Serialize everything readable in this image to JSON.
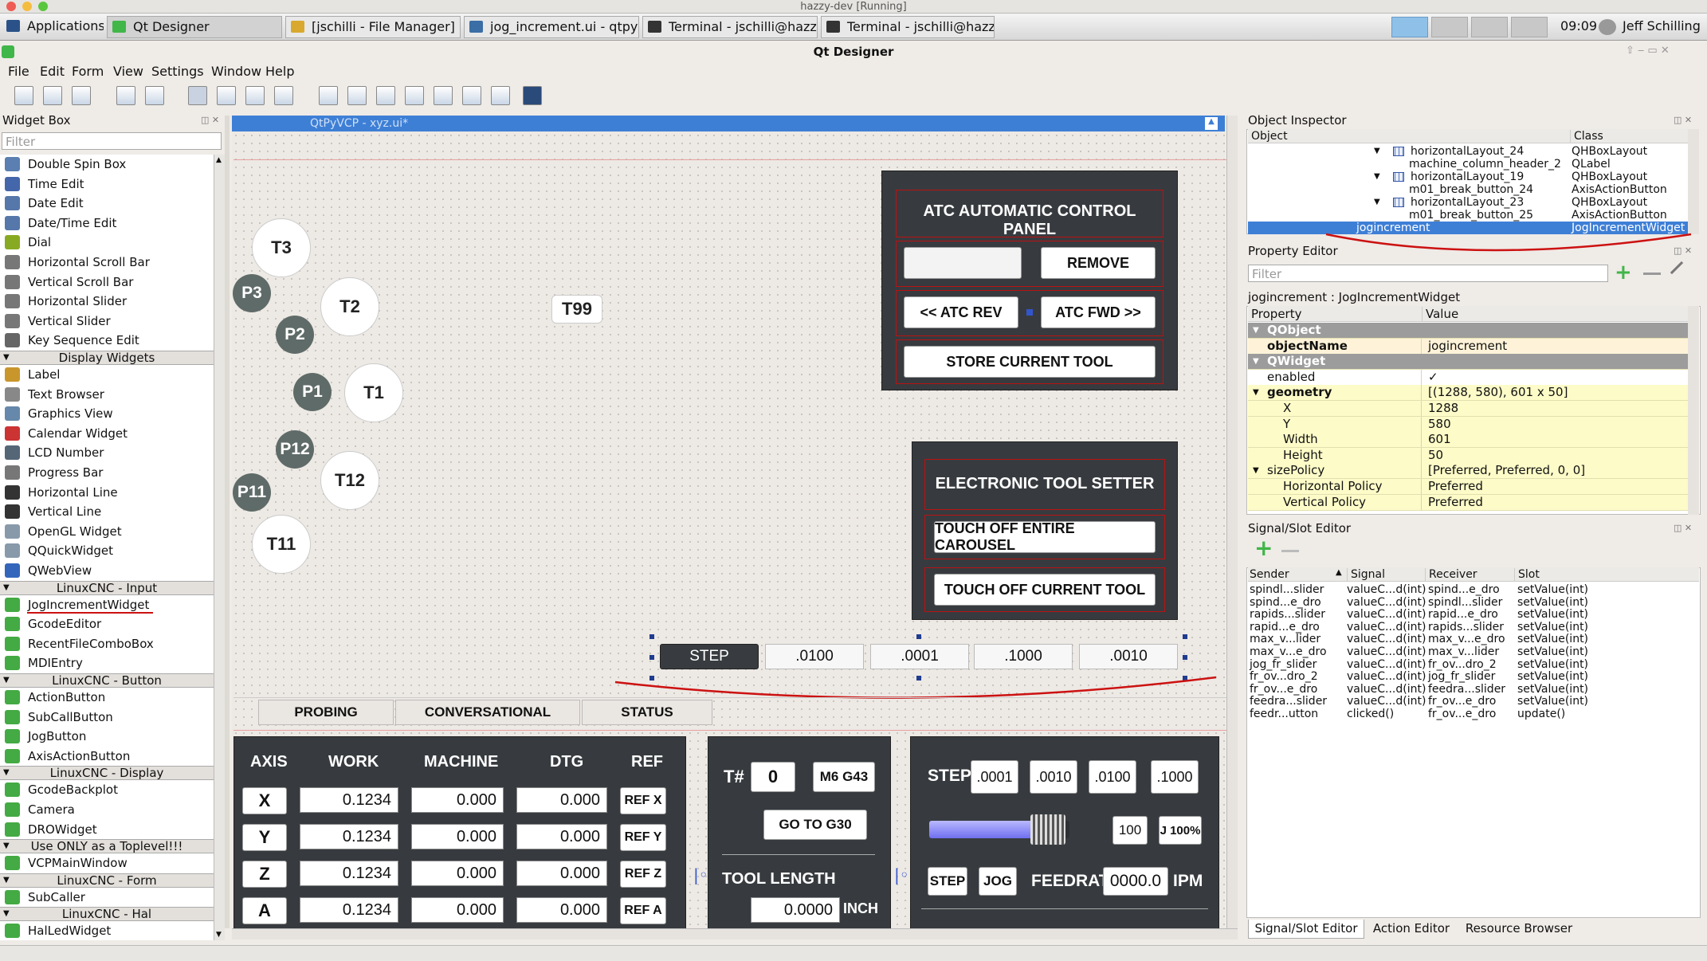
{
  "window": {
    "title": "hazzy-dev [Running]",
    "app_title": "Qt Designer"
  },
  "taskbar": {
    "applications": "Applications",
    "tasks": [
      "Qt Designer",
      "[jschilli - File Manager]",
      "jog_increment.ui - qtpyv...",
      "Terminal - jschilli@hazz...",
      "Terminal - jschilli@hazz..."
    ],
    "clock": "09:09",
    "user": "Jeff Schilling"
  },
  "menu": [
    "File",
    "Edit",
    "Form",
    "View",
    "Settings",
    "Window",
    "Help"
  ],
  "widget_box": {
    "title": "Widget Box",
    "filter_placeholder": "Filter",
    "items": [
      {
        "t": "item",
        "label": "Double Spin Box",
        "color": "#5a7fb0"
      },
      {
        "t": "item",
        "label": "Time Edit",
        "color": "#4466aa"
      },
      {
        "t": "item",
        "label": "Date Edit",
        "color": "#5577aa"
      },
      {
        "t": "item",
        "label": "Date/Time Edit",
        "color": "#5577aa"
      },
      {
        "t": "item",
        "label": "Dial",
        "color": "#88aa22"
      },
      {
        "t": "item",
        "label": "Horizontal Scroll Bar",
        "color": "#777777"
      },
      {
        "t": "item",
        "label": "Vertical Scroll Bar",
        "color": "#777777"
      },
      {
        "t": "item",
        "label": "Horizontal Slider",
        "color": "#777777"
      },
      {
        "t": "item",
        "label": "Vertical Slider",
        "color": "#777777"
      },
      {
        "t": "item",
        "label": "Key Sequence Edit",
        "color": "#666666"
      },
      {
        "t": "cat",
        "label": "Display Widgets"
      },
      {
        "t": "item",
        "label": "Label",
        "color": "#c9962c"
      },
      {
        "t": "item",
        "label": "Text Browser",
        "color": "#888888"
      },
      {
        "t": "item",
        "label": "Graphics View",
        "color": "#6688aa"
      },
      {
        "t": "item",
        "label": "Calendar Widget",
        "color": "#cc3333"
      },
      {
        "t": "item",
        "label": "LCD Number",
        "color": "#556677"
      },
      {
        "t": "item",
        "label": "Progress Bar",
        "color": "#777777"
      },
      {
        "t": "item",
        "label": "Horizontal Line",
        "color": "#333333"
      },
      {
        "t": "item",
        "label": "Vertical Line",
        "color": "#333333"
      },
      {
        "t": "item",
        "label": "OpenGL Widget",
        "color": "#8899aa"
      },
      {
        "t": "item",
        "label": "QQuickWidget",
        "color": "#8899aa"
      },
      {
        "t": "item",
        "label": "QWebView",
        "color": "#3366bb"
      },
      {
        "t": "cat",
        "label": "LinuxCNC - Input"
      },
      {
        "t": "item",
        "label": "JogIncrementWidget",
        "color": "#44aa44"
      },
      {
        "t": "item",
        "label": "GcodeEditor",
        "color": "#44aa44"
      },
      {
        "t": "item",
        "label": "RecentFileComboBox",
        "color": "#44aa44"
      },
      {
        "t": "item",
        "label": "MDIEntry",
        "color": "#44aa44"
      },
      {
        "t": "cat",
        "label": "LinuxCNC - Button"
      },
      {
        "t": "item",
        "label": "ActionButton",
        "color": "#44aa44"
      },
      {
        "t": "item",
        "label": "SubCallButton",
        "color": "#44aa44"
      },
      {
        "t": "item",
        "label": "JogButton",
        "color": "#44aa44"
      },
      {
        "t": "item",
        "label": "AxisActionButton",
        "color": "#44aa44"
      },
      {
        "t": "cat",
        "label": "LinuxCNC - Display"
      },
      {
        "t": "item",
        "label": "GcodeBackplot",
        "color": "#44aa44"
      },
      {
        "t": "item",
        "label": "Camera",
        "color": "#44aa44"
      },
      {
        "t": "item",
        "label": "DROWidget",
        "color": "#44aa44"
      },
      {
        "t": "cat",
        "label": "Use ONLY as a Toplevel!!!"
      },
      {
        "t": "item",
        "label": "VCPMainWindow",
        "color": "#44aa44"
      },
      {
        "t": "cat",
        "label": "LinuxCNC - Form"
      },
      {
        "t": "item",
        "label": "SubCaller",
        "color": "#44aa44"
      },
      {
        "t": "cat",
        "label": "LinuxCNC - Hal"
      },
      {
        "t": "item",
        "label": "HalLedWidget",
        "color": "#44aa44"
      }
    ]
  },
  "form": {
    "title": "QtPyVCP - xyz.ui*",
    "tools": [
      "T3",
      "T2",
      "T1",
      "T12",
      "T11"
    ],
    "pockets": [
      "P3",
      "P2",
      "P1",
      "P12",
      "P11"
    ],
    "t99": "T99",
    "atc": {
      "title": "ATC AUTOMATIC CONTROL PANEL",
      "remove": "REMOVE",
      "rev": "<< ATC REV",
      "fwd": "ATC FWD >>",
      "store": "STORE CURRENT TOOL"
    },
    "ets": {
      "title": "ELECTRONIC TOOL SETTER",
      "carousel": "TOUCH OFF ENTIRE CAROUSEL",
      "current": "TOUCH OFF CURRENT TOOL"
    },
    "jogbar": {
      "step": "STEP",
      "incs": [
        ".0100",
        ".0001",
        ".1000",
        ".0010"
      ]
    },
    "tabs": [
      "PROBING",
      "CONVERSATIONAL",
      "STATUS"
    ],
    "dro": {
      "headers": [
        "AXIS",
        "WORK",
        "MACHINE",
        "DTG",
        "REF"
      ],
      "rows": [
        {
          "axis": "X",
          "work": "0.1234",
          "machine": "0.000",
          "dtg": "0.000",
          "ref": "REF X"
        },
        {
          "axis": "Y",
          "work": "0.1234",
          "machine": "0.000",
          "dtg": "0.000",
          "ref": "REF Y"
        },
        {
          "axis": "Z",
          "work": "0.1234",
          "machine": "0.000",
          "dtg": "0.000",
          "ref": "REF Z"
        },
        {
          "axis": "A",
          "work": "0.1234",
          "machine": "0.000",
          "dtg": "0.000",
          "ref": "REF A"
        }
      ]
    },
    "toolinfo": {
      "tnum_label": "T#",
      "tnum": "0",
      "m6": "M6 G43",
      "g30": "GO TO G30",
      "tool_length_label": "TOOL LENGTH",
      "tool_length": "0.0000",
      "unit": "INCH"
    },
    "jog": {
      "step_label": "STEP",
      "incs": [
        ".0001",
        ".0010",
        ".0100",
        ".1000"
      ],
      "slider_value": "100",
      "jog_pct": "J 100%",
      "slider_fraction": 0.78,
      "step_btn": "STEP",
      "jog_btn": "JOG",
      "feedrate_label": "FEEDRATE",
      "feedrate": "0000.0",
      "ipm": "IPM"
    }
  },
  "object_inspector": {
    "title": "Object Inspector",
    "col_object": "Object",
    "col_class": "Class",
    "rows": [
      {
        "obj": "horizontalLayout_24",
        "cls": "QHBoxLayout",
        "indent": 1
      },
      {
        "obj": "machine_column_header_2",
        "cls": "QLabel",
        "indent": 2
      },
      {
        "obj": "horizontalLayout_19",
        "cls": "QHBoxLayout",
        "indent": 1
      },
      {
        "obj": "m01_break_button_24",
        "cls": "AxisActionButton",
        "indent": 2
      },
      {
        "obj": "horizontalLayout_23",
        "cls": "QHBoxLayout",
        "indent": 1
      },
      {
        "obj": "m01_break_button_25",
        "cls": "AxisActionButton",
        "indent": 2
      },
      {
        "obj": "jogincrement",
        "cls": "JogIncrementWidget",
        "indent": 0,
        "selected": true
      }
    ]
  },
  "property_editor": {
    "title": "Property Editor",
    "filter_placeholder": "Filter",
    "header": "jogincrement : JogIncrementWidget",
    "col_property": "Property",
    "col_value": "Value",
    "rows": [
      {
        "k": "QObject",
        "v": "",
        "type": "group"
      },
      {
        "k": "objectName",
        "v": "jogincrement",
        "type": "bold"
      },
      {
        "k": "QWidget",
        "v": "",
        "type": "group"
      },
      {
        "k": "enabled",
        "v": "✓",
        "type": "plain"
      },
      {
        "k": "geometry",
        "v": "[(1288, 580), 601 x 50]",
        "type": "bold"
      },
      {
        "k": "X",
        "v": "1288",
        "type": "sub"
      },
      {
        "k": "Y",
        "v": "580",
        "type": "sub"
      },
      {
        "k": "Width",
        "v": "601",
        "type": "sub"
      },
      {
        "k": "Height",
        "v": "50",
        "type": "sub"
      },
      {
        "k": "sizePolicy",
        "v": "[Preferred, Preferred, 0, 0]",
        "type": "plain"
      },
      {
        "k": "Horizontal Policy",
        "v": "Preferred",
        "type": "sub"
      },
      {
        "k": "Vertical Policy",
        "v": "Preferred",
        "type": "sub"
      }
    ]
  },
  "signal_slot": {
    "title": "Signal/Slot Editor",
    "cols": [
      "Sender",
      "Signal",
      "Receiver",
      "Slot"
    ],
    "rows": [
      [
        "spindl...slider",
        "valueC...d(int)",
        "spind...e_dro",
        "setValue(int)"
      ],
      [
        "spind...e_dro",
        "valueC...d(int)",
        "spindl...slider",
        "setValue(int)"
      ],
      [
        "rapids...slider",
        "valueC...d(int)",
        "rapid...e_dro",
        "setValue(int)"
      ],
      [
        "rapid...e_dro",
        "valueC...d(int)",
        "rapids...slider",
        "setValue(int)"
      ],
      [
        "max_v...lider",
        "valueC...d(int)",
        "max_v...e_dro",
        "setValue(int)"
      ],
      [
        "max_v...e_dro",
        "valueC...d(int)",
        "max_v...lider",
        "setValue(int)"
      ],
      [
        "jog_fr_slider",
        "valueC...d(int)",
        "fr_ov...dro_2",
        "setValue(int)"
      ],
      [
        "fr_ov...dro_2",
        "valueC...d(int)",
        "jog_fr_slider",
        "setValue(int)"
      ],
      [
        "fr_ov...e_dro",
        "valueC...d(int)",
        "feedra...slider",
        "setValue(int)"
      ],
      [
        "feedra...slider",
        "valueC...d(int)",
        "fr_ov...e_dro",
        "setValue(int)"
      ],
      [
        "feedr...utton",
        "clicked()",
        "fr_ov...e_dro",
        "update()"
      ]
    ]
  },
  "bottom_tabs": [
    "Signal/Slot Editor",
    "Action Editor",
    "Resource Browser"
  ],
  "colors": {
    "accent": "#3e7fd6",
    "panel": "#373b3f",
    "red": "#cc1111"
  }
}
